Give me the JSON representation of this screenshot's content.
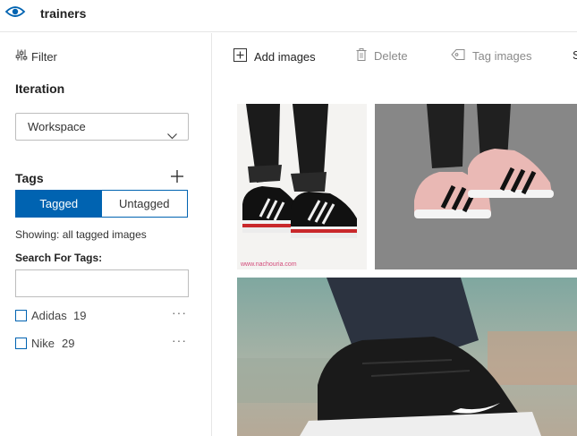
{
  "app": {
    "title": "trainers"
  },
  "sidebar": {
    "filter_label": "Filter",
    "iteration_label": "Iteration",
    "iteration_value": "Workspace",
    "tags_label": "Tags",
    "toggle": {
      "tagged": "Tagged",
      "untagged": "Untagged"
    },
    "showing_text": "Showing: all tagged images",
    "search_label": "Search For Tags:",
    "search_placeholder": "",
    "tags": [
      {
        "name": "Adidas",
        "count": "19"
      },
      {
        "name": "Nike",
        "count": "29"
      }
    ]
  },
  "toolbar": {
    "add_images": "Add images",
    "delete": "Delete",
    "tag_images": "Tag images",
    "overflow_letter": "S"
  },
  "images": [
    {
      "watermark": "www.nachouria.com"
    },
    {
      "watermark": ""
    },
    {
      "watermark": ""
    }
  ],
  "colors": {
    "accent": "#0063b1",
    "disabled": "#8a8a8a"
  }
}
